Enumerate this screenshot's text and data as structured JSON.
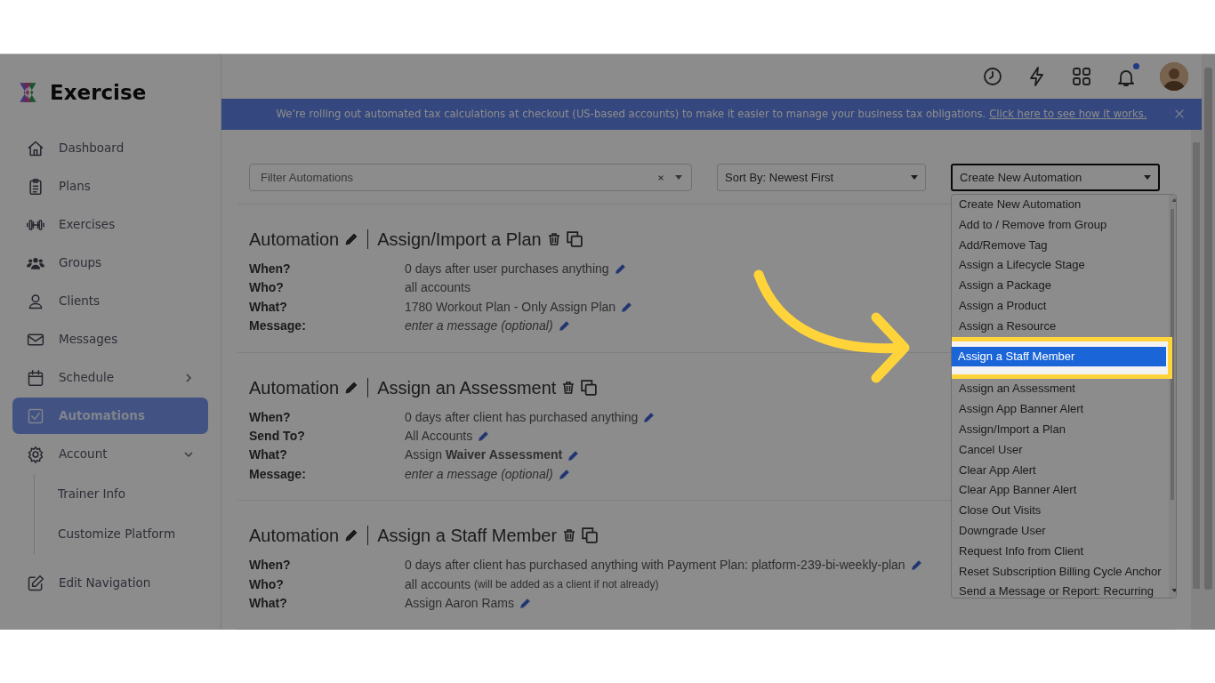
{
  "app": {
    "name": "Exercise"
  },
  "sidebar": {
    "items": [
      {
        "label": "Dashboard",
        "kind": "link",
        "selected": false
      },
      {
        "label": "Plans",
        "kind": "link",
        "selected": false
      },
      {
        "label": "Exercises",
        "kind": "link",
        "selected": false
      },
      {
        "label": "Groups",
        "kind": "link",
        "selected": false
      },
      {
        "label": "Clients",
        "kind": "link",
        "selected": false
      },
      {
        "label": "Messages",
        "kind": "link",
        "selected": false
      },
      {
        "label": "Schedule",
        "kind": "group",
        "selected": false,
        "expanded": false
      },
      {
        "label": "Automations",
        "kind": "link",
        "selected": true
      },
      {
        "label": "Account",
        "kind": "group",
        "selected": false,
        "expanded": true,
        "children": [
          {
            "label": "Trainer Info",
            "selected": false
          },
          {
            "label": "Customize Platform",
            "selected": false
          }
        ]
      },
      {
        "label": "Edit Navigation",
        "kind": "footer",
        "selected": false
      }
    ]
  },
  "header": {
    "notifications_unread": true
  },
  "banner": {
    "text": "We’re rolling out automated tax calculations at checkout (US-based accounts) to make it easier to manage your business tax obligations.",
    "link": "Click here to see how it works."
  },
  "toolbar": {
    "filter": {
      "placeholder": "Filter Automations"
    },
    "sort": {
      "value": "Sort By: Newest First"
    },
    "create": {
      "value": "Create New Automation"
    }
  },
  "dropdown": {
    "options": [
      {
        "label": "Create New Automation",
        "selected": false
      },
      {
        "label": "Add to / Remove from Group",
        "selected": false
      },
      {
        "label": "Add/Remove Tag",
        "selected": false
      },
      {
        "label": "Assign a Lifecycle Stage",
        "selected": false
      },
      {
        "label": "Assign a Package",
        "selected": false
      },
      {
        "label": "Assign a Product",
        "selected": false
      },
      {
        "label": "Assign a Resource",
        "selected": false
      },
      {
        "label": "Assign a Staff Member",
        "selected": true
      },
      {
        "label": "Assign an Assessment",
        "selected": false
      },
      {
        "label": "Assign App Banner Alert",
        "selected": false
      },
      {
        "label": "Assign/Import a Plan",
        "selected": false
      },
      {
        "label": "Cancel User",
        "selected": false
      },
      {
        "label": "Clear App Alert",
        "selected": false
      },
      {
        "label": "Clear App Banner Alert",
        "selected": false
      },
      {
        "label": "Close Out Visits",
        "selected": false
      },
      {
        "label": "Downgrade User",
        "selected": false
      },
      {
        "label": "Request Info from Client",
        "selected": false
      },
      {
        "label": "Reset Subscription Billing Cycle Anchor",
        "selected": false
      },
      {
        "label": "Send a Message or Report: Recurring",
        "selected": false
      }
    ]
  },
  "automations": [
    {
      "label": "Automation",
      "type": "Assign/Import a Plan",
      "fields": [
        {
          "label": "When?",
          "value": "0 days after user purchases anything",
          "kind": "text",
          "editable": true
        },
        {
          "label": "Who?",
          "value": "all accounts",
          "kind": "text",
          "editable": false
        },
        {
          "label": "What?",
          "value": "1780 Workout Plan - Only Assign Plan",
          "kind": "text",
          "editable": true
        },
        {
          "label": "Message:",
          "value": "enter a message (optional)",
          "kind": "placeholder",
          "editable": true
        }
      ]
    },
    {
      "label": "Automation",
      "type": "Assign an Assessment",
      "fields": [
        {
          "label": "When?",
          "value": "0 days after client has purchased anything",
          "kind": "text",
          "editable": true
        },
        {
          "label": "Send To?",
          "value": "All Accounts",
          "kind": "text",
          "editable": true
        },
        {
          "label": "What?",
          "value": "Assign **Waiver Assessment**",
          "kind": "text",
          "editable": true
        },
        {
          "label": "Message:",
          "value": "enter a message (optional)",
          "kind": "placeholder",
          "editable": true
        }
      ]
    },
    {
      "label": "Automation",
      "type": "Assign a Staff Member",
      "fields": [
        {
          "label": "When?",
          "value": "0 days after client has purchased anything with Payment Plan: platform-239-bi-weekly-plan",
          "kind": "text",
          "editable": true
        },
        {
          "label": "Who?",
          "value": "all accounts",
          "note": "(will be added as a client if not already)",
          "kind": "text",
          "editable": false
        },
        {
          "label": "What?",
          "value": "Assign Aaron Rams",
          "kind": "text",
          "editable": true
        }
      ]
    }
  ]
}
